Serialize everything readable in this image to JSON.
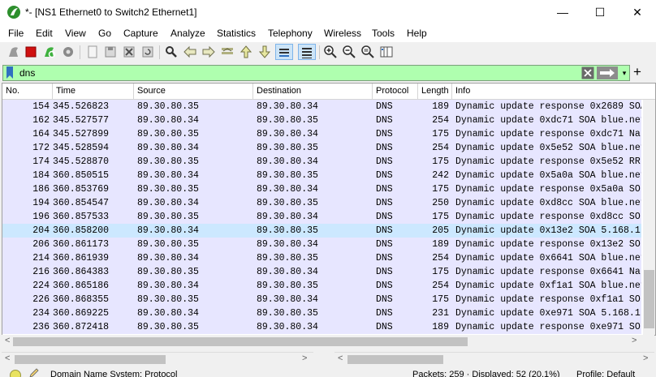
{
  "window": {
    "title": "*- [NS1 Ethernet0 to Switch2 Ethernet1]",
    "minimize_glyph": "—",
    "maximize_glyph": "☐",
    "close_glyph": "✕"
  },
  "menu": [
    "File",
    "Edit",
    "View",
    "Go",
    "Capture",
    "Analyze",
    "Statistics",
    "Telephony",
    "Wireless",
    "Tools",
    "Help"
  ],
  "toolbar": {
    "icons": [
      "shark-fin-start-icon",
      "stop-square-icon",
      "restart-capture-icon",
      "capture-options-icon",
      "open-file-icon",
      "save-file-icon",
      "close-file-icon",
      "reload-file-icon",
      "find-packet-icon",
      "go-back-icon",
      "go-forward-icon",
      "go-to-packet-icon",
      "go-first-packet-icon",
      "go-last-packet-icon",
      "auto-scroll-icon",
      "colorize-icon",
      "zoom-in-icon",
      "zoom-out-icon",
      "zoom-normal-icon",
      "resize-columns-icon"
    ],
    "accent_red": "#d01010",
    "accent_green": "#3fb13f"
  },
  "filter": {
    "value": "dns",
    "background": "#afffaf",
    "add_glyph": "+",
    "dropdown_glyph": "▾"
  },
  "columns": [
    "No.",
    "Time",
    "Source",
    "Destination",
    "Protocol",
    "Length",
    "Info"
  ],
  "packets": [
    {
      "no": "154",
      "time": "345.526823",
      "src": "89.30.80.35",
      "dst": "89.30.80.34",
      "proto": "DNS",
      "len": "189",
      "info": "Dynamic update response 0x2689 SOA"
    },
    {
      "no": "162",
      "time": "345.527577",
      "src": "89.30.80.34",
      "dst": "89.30.80.35",
      "proto": "DNS",
      "len": "254",
      "info": "Dynamic update 0xdc71 SOA blue.net"
    },
    {
      "no": "164",
      "time": "345.527899",
      "src": "89.30.80.35",
      "dst": "89.30.80.34",
      "proto": "DNS",
      "len": "175",
      "info": "Dynamic update response 0xdc71 Na"
    },
    {
      "no": "172",
      "time": "345.528594",
      "src": "89.30.80.34",
      "dst": "89.30.80.35",
      "proto": "DNS",
      "len": "254",
      "info": "Dynamic update 0x5e52 SOA blue.net"
    },
    {
      "no": "174",
      "time": "345.528870",
      "src": "89.30.80.35",
      "dst": "89.30.80.34",
      "proto": "DNS",
      "len": "175",
      "info": "Dynamic update response 0x5e52 RR"
    },
    {
      "no": "184",
      "time": "360.850515",
      "src": "89.30.80.34",
      "dst": "89.30.80.35",
      "proto": "DNS",
      "len": "242",
      "info": "Dynamic update 0x5a0a SOA blue.net"
    },
    {
      "no": "186",
      "time": "360.853769",
      "src": "89.30.80.35",
      "dst": "89.30.80.34",
      "proto": "DNS",
      "len": "175",
      "info": "Dynamic update response 0x5a0a SO"
    },
    {
      "no": "194",
      "time": "360.854547",
      "src": "89.30.80.34",
      "dst": "89.30.80.35",
      "proto": "DNS",
      "len": "250",
      "info": "Dynamic update 0xd8cc SOA blue.net"
    },
    {
      "no": "196",
      "time": "360.857533",
      "src": "89.30.80.35",
      "dst": "89.30.80.34",
      "proto": "DNS",
      "len": "175",
      "info": "Dynamic update response 0xd8cc SO"
    },
    {
      "no": "204",
      "time": "360.858200",
      "src": "89.30.80.34",
      "dst": "89.30.80.35",
      "proto": "DNS",
      "len": "205",
      "info": "Dynamic update 0x13e2 SOA 5.168.1"
    },
    {
      "no": "206",
      "time": "360.861173",
      "src": "89.30.80.35",
      "dst": "89.30.80.34",
      "proto": "DNS",
      "len": "189",
      "info": "Dynamic update response 0x13e2 SO"
    },
    {
      "no": "214",
      "time": "360.861939",
      "src": "89.30.80.34",
      "dst": "89.30.80.35",
      "proto": "DNS",
      "len": "254",
      "info": "Dynamic update 0x6641 SOA blue.net"
    },
    {
      "no": "216",
      "time": "360.864383",
      "src": "89.30.80.35",
      "dst": "89.30.80.34",
      "proto": "DNS",
      "len": "175",
      "info": "Dynamic update response 0x6641 Na"
    },
    {
      "no": "224",
      "time": "360.865186",
      "src": "89.30.80.34",
      "dst": "89.30.80.35",
      "proto": "DNS",
      "len": "254",
      "info": "Dynamic update 0xf1a1 SOA blue.net"
    },
    {
      "no": "226",
      "time": "360.868355",
      "src": "89.30.80.35",
      "dst": "89.30.80.34",
      "proto": "DNS",
      "len": "175",
      "info": "Dynamic update response 0xf1a1 SO"
    },
    {
      "no": "234",
      "time": "360.869225",
      "src": "89.30.80.34",
      "dst": "89.30.80.35",
      "proto": "DNS",
      "len": "231",
      "info": "Dynamic update 0xe971 SOA 5.168.1"
    },
    {
      "no": "236",
      "time": "360.872418",
      "src": "89.30.80.35",
      "dst": "89.30.80.34",
      "proto": "DNS",
      "len": "189",
      "info": "Dynamic update response 0xe971 SO"
    }
  ],
  "selected_packet": "204",
  "row_colors": {
    "normal": "#e7e6ff",
    "selected": "#cce8ff"
  },
  "scroll_glyphs": {
    "left": "<",
    "right": ">",
    "up": "^",
    "down": "v"
  },
  "status": {
    "info": "Domain Name System: Protocol",
    "packets": "Packets: 259 · Displayed: 52 (20.1%)",
    "profile": "Profile: Default"
  }
}
